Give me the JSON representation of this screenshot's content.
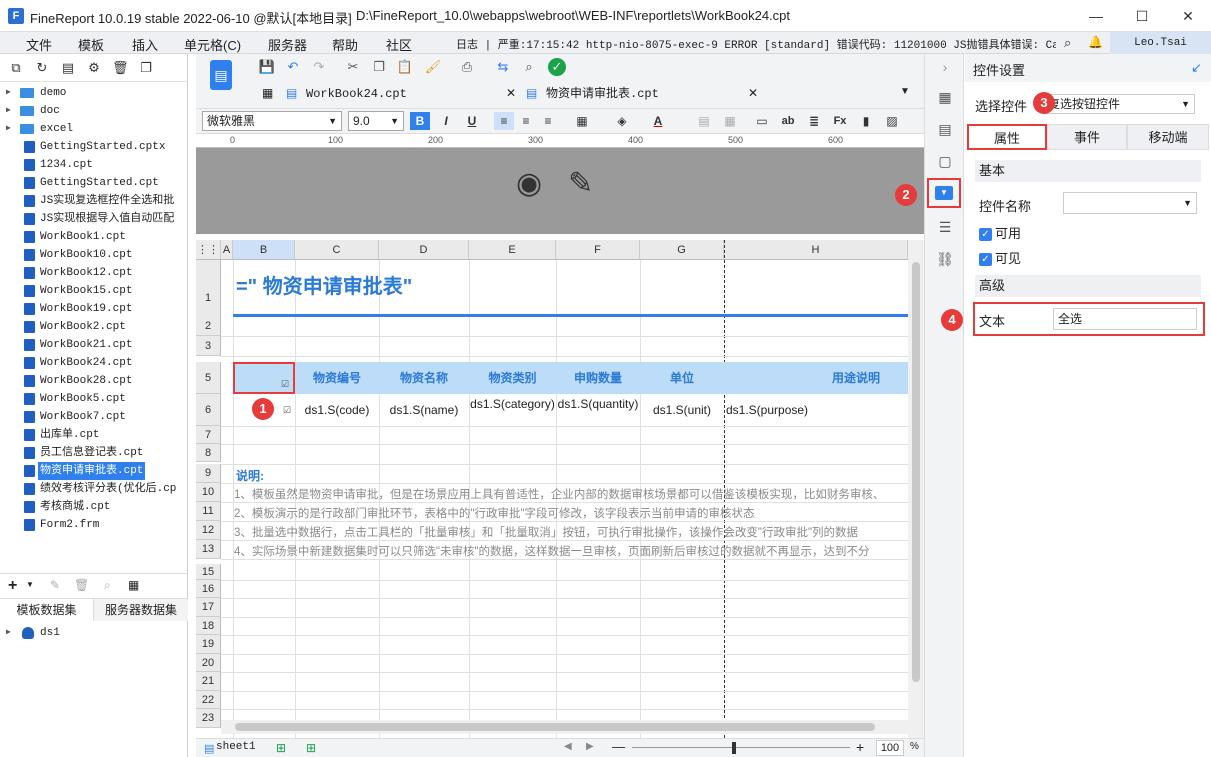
{
  "window": {
    "title": "FineReport 10.0.19 stable 2022-06-10 @默认[本地目录]",
    "path": "D:\\FineReport_10.0\\webapps\\webroot\\WEB-INF\\reportlets\\WorkBook24.cpt",
    "logo": "F"
  },
  "menu": {
    "items": [
      "文件",
      "模板",
      "插入",
      "单元格(C)",
      "服务器",
      "帮助",
      "社区"
    ],
    "log": "日志 | 严重:17:15:42 http-nio-8075-exec-9 ERROR [standard] 错误代码: 11201000 JS抛错具体错误: Can...",
    "user": "Leo.Tsai"
  },
  "tree": {
    "items": [
      {
        "type": "folder",
        "label": "demo"
      },
      {
        "type": "folder",
        "label": "doc"
      },
      {
        "type": "folder",
        "label": "excel"
      },
      {
        "type": "file",
        "label": "GettingStarted.cptx"
      },
      {
        "type": "file",
        "label": "1234.cpt"
      },
      {
        "type": "file",
        "label": "GettingStarted.cpt"
      },
      {
        "type": "file",
        "label": "JS实现复选框控件全选和批"
      },
      {
        "type": "file",
        "label": "JS实现根据导入值自动匹配"
      },
      {
        "type": "file",
        "label": "WorkBook1.cpt"
      },
      {
        "type": "file",
        "label": "WorkBook10.cpt"
      },
      {
        "type": "file",
        "label": "WorkBook12.cpt"
      },
      {
        "type": "file",
        "label": "WorkBook15.cpt"
      },
      {
        "type": "file",
        "label": "WorkBook19.cpt"
      },
      {
        "type": "file",
        "label": "WorkBook2.cpt"
      },
      {
        "type": "file",
        "label": "WorkBook21.cpt"
      },
      {
        "type": "file",
        "label": "WorkBook24.cpt"
      },
      {
        "type": "file",
        "label": "WorkBook28.cpt"
      },
      {
        "type": "file",
        "label": "WorkBook5.cpt"
      },
      {
        "type": "file",
        "label": "WorkBook7.cpt"
      },
      {
        "type": "file",
        "label": "出库单.cpt"
      },
      {
        "type": "file",
        "label": "员工信息登记表.cpt"
      },
      {
        "type": "file",
        "label": "物资申请审批表.cpt",
        "selected": true
      },
      {
        "type": "file",
        "label": "绩效考核评分表(优化后.cp"
      },
      {
        "type": "file",
        "label": "考核商城.cpt"
      },
      {
        "type": "file",
        "label": "Form2.frm"
      }
    ]
  },
  "datasets": {
    "tab1": "模板数据集",
    "tab2": "服务器数据集",
    "item": "ds1"
  },
  "editor": {
    "tab1": "WorkBook24.cpt",
    "tab2": "物资申请审批表.cpt",
    "font": "微软雅黑",
    "size": "9.0",
    "bold": "B",
    "italic": "I",
    "underline": "U",
    "ruler": [
      "0",
      "100",
      "200",
      "300",
      "400",
      "500",
      "600"
    ]
  },
  "sheet": {
    "cols": [
      "A",
      "B",
      "C",
      "D",
      "E",
      "F",
      "G",
      "H"
    ],
    "rows": [
      "1",
      "2",
      "3",
      "5",
      "6",
      "7",
      "8",
      "9",
      "10",
      "11",
      "12",
      "13",
      "15",
      "16",
      "17",
      "18",
      "19",
      "20",
      "21",
      "22",
      "23"
    ],
    "title": "=\"  物资申请审批表\"",
    "headers": [
      "物资编号",
      "物资名称",
      "物资类别",
      "申购数量",
      "单位",
      "用途说明"
    ],
    "data": [
      "ds1.S(code)",
      "ds1.S(name)",
      "ds1.S(category)",
      "ds1.S(quantity)",
      "ds1.S(unit)",
      "ds1.S(purpose)"
    ],
    "note_title": "说明:",
    "notes": [
      "1、模板虽然是物资申请审批，但是在场景应用上具有普适性，企业内部的数据审核场景都可以借鉴该模板实现，比如财务审核、",
      "2、模板演示的是行政部门审批环节，表格中的\"行政审批\"字段可修改，该字段表示当前申请的审核状态",
      "3、批量选中数据行，点击工具栏的「批量审核」和「批量取消」按钮，可执行审批操作，该操作会改变\"行政审批\"列的数据",
      "4、实际场景中新建数据集时可以只筛选\"未审核\"的数据，这样数据一旦审核，页面刷新后审核过的数据就不再显示，达到不分"
    ],
    "sheet_tab": "sheet1",
    "zoom": "100",
    "zoom_unit": "%"
  },
  "panel": {
    "title": "控件设置",
    "select_label": "选择控件",
    "select_value": "复选按钮控件",
    "tabs": [
      "属性",
      "事件",
      "移动端"
    ],
    "basic": "基本",
    "name_label": "控件名称",
    "name_value": "",
    "enabled": "可用",
    "visible": "可见",
    "advanced": "高级",
    "text_label": "文本",
    "text_value": "全选"
  },
  "markers": [
    "1",
    "2",
    "3",
    "4"
  ],
  "colors": {
    "accent": "#2f80ed",
    "marker": "#e63b3b",
    "header_bg": "#bcdcf7"
  }
}
